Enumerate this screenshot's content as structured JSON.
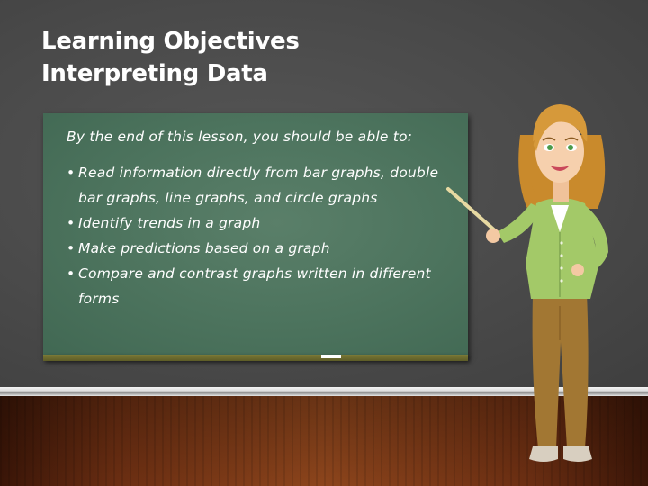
{
  "slide": {
    "title_line1": "Learning Objectives",
    "title_line2": "Interpreting Data"
  },
  "board": {
    "intro": "By the end of this lesson, you should be able to:",
    "bullets": [
      "Read information directly from bar graphs, double bar graphs, line graphs, and circle graphs",
      "Identify trends in a graph",
      "Make predictions based on a graph",
      "Compare and contrast graphs written in different forms"
    ]
  },
  "colors": {
    "wall": "#4b4b4b",
    "chalkboard": "#4f7660",
    "ledge": "#6e6c2e",
    "floor": "#7a3a17",
    "title_text": "#ffffff"
  }
}
